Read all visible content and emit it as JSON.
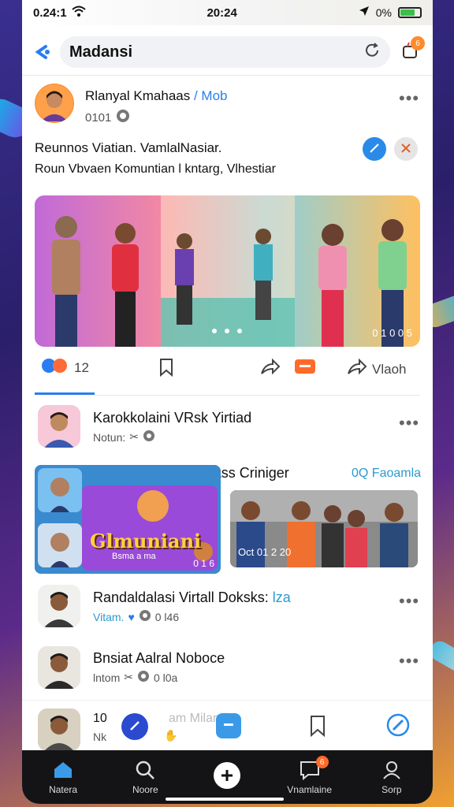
{
  "status_bar": {
    "carrier": "0.24:1",
    "time": "20:24",
    "battery_text": "0%"
  },
  "header": {
    "search_text": "Madansi",
    "notif_count": "6"
  },
  "post1": {
    "author": "Rlanyal Kmahaas",
    "author_link": "/ Mob",
    "meta": "0101",
    "line1": "Reunnos Viatian. VamlalNasiar.",
    "line2": "Roun Vbvaen Komuntian l kntarg, Vlhestiar",
    "image_counter": "0 1 0 0 5"
  },
  "actions": {
    "reactions": "12",
    "share_label": "Vlaoh"
  },
  "post2": {
    "author": "Karokkolaini VRsk Yirtiad",
    "meta": "Notun:"
  },
  "post3": {
    "title": "DomamKaltac Vintiass Criniger",
    "title_link": "0Q Faoamla",
    "game_title": "Glmuniani",
    "game_sub": "Bsma a ma",
    "game_counter": "0 1 6",
    "photo_label": "Oct 01 2 20"
  },
  "post4": {
    "title": "Randaldalasi Virtall Doksks:",
    "title_link": "lza",
    "meta": "Vitam.",
    "meta2": "0 l46"
  },
  "post5": {
    "title": "Bnsiat Aalral Noboce",
    "meta": "lntom",
    "meta2": "0 l0a"
  },
  "bottom_card": {
    "title": "10",
    "meta": "Nk",
    "title_ghost": "am Miland"
  },
  "nav": {
    "items": [
      {
        "label": "Natera"
      },
      {
        "label": "Noore"
      },
      {
        "label": ""
      },
      {
        "label": "Vnamlaine",
        "badge": "6"
      },
      {
        "label": "Sorp"
      }
    ]
  }
}
